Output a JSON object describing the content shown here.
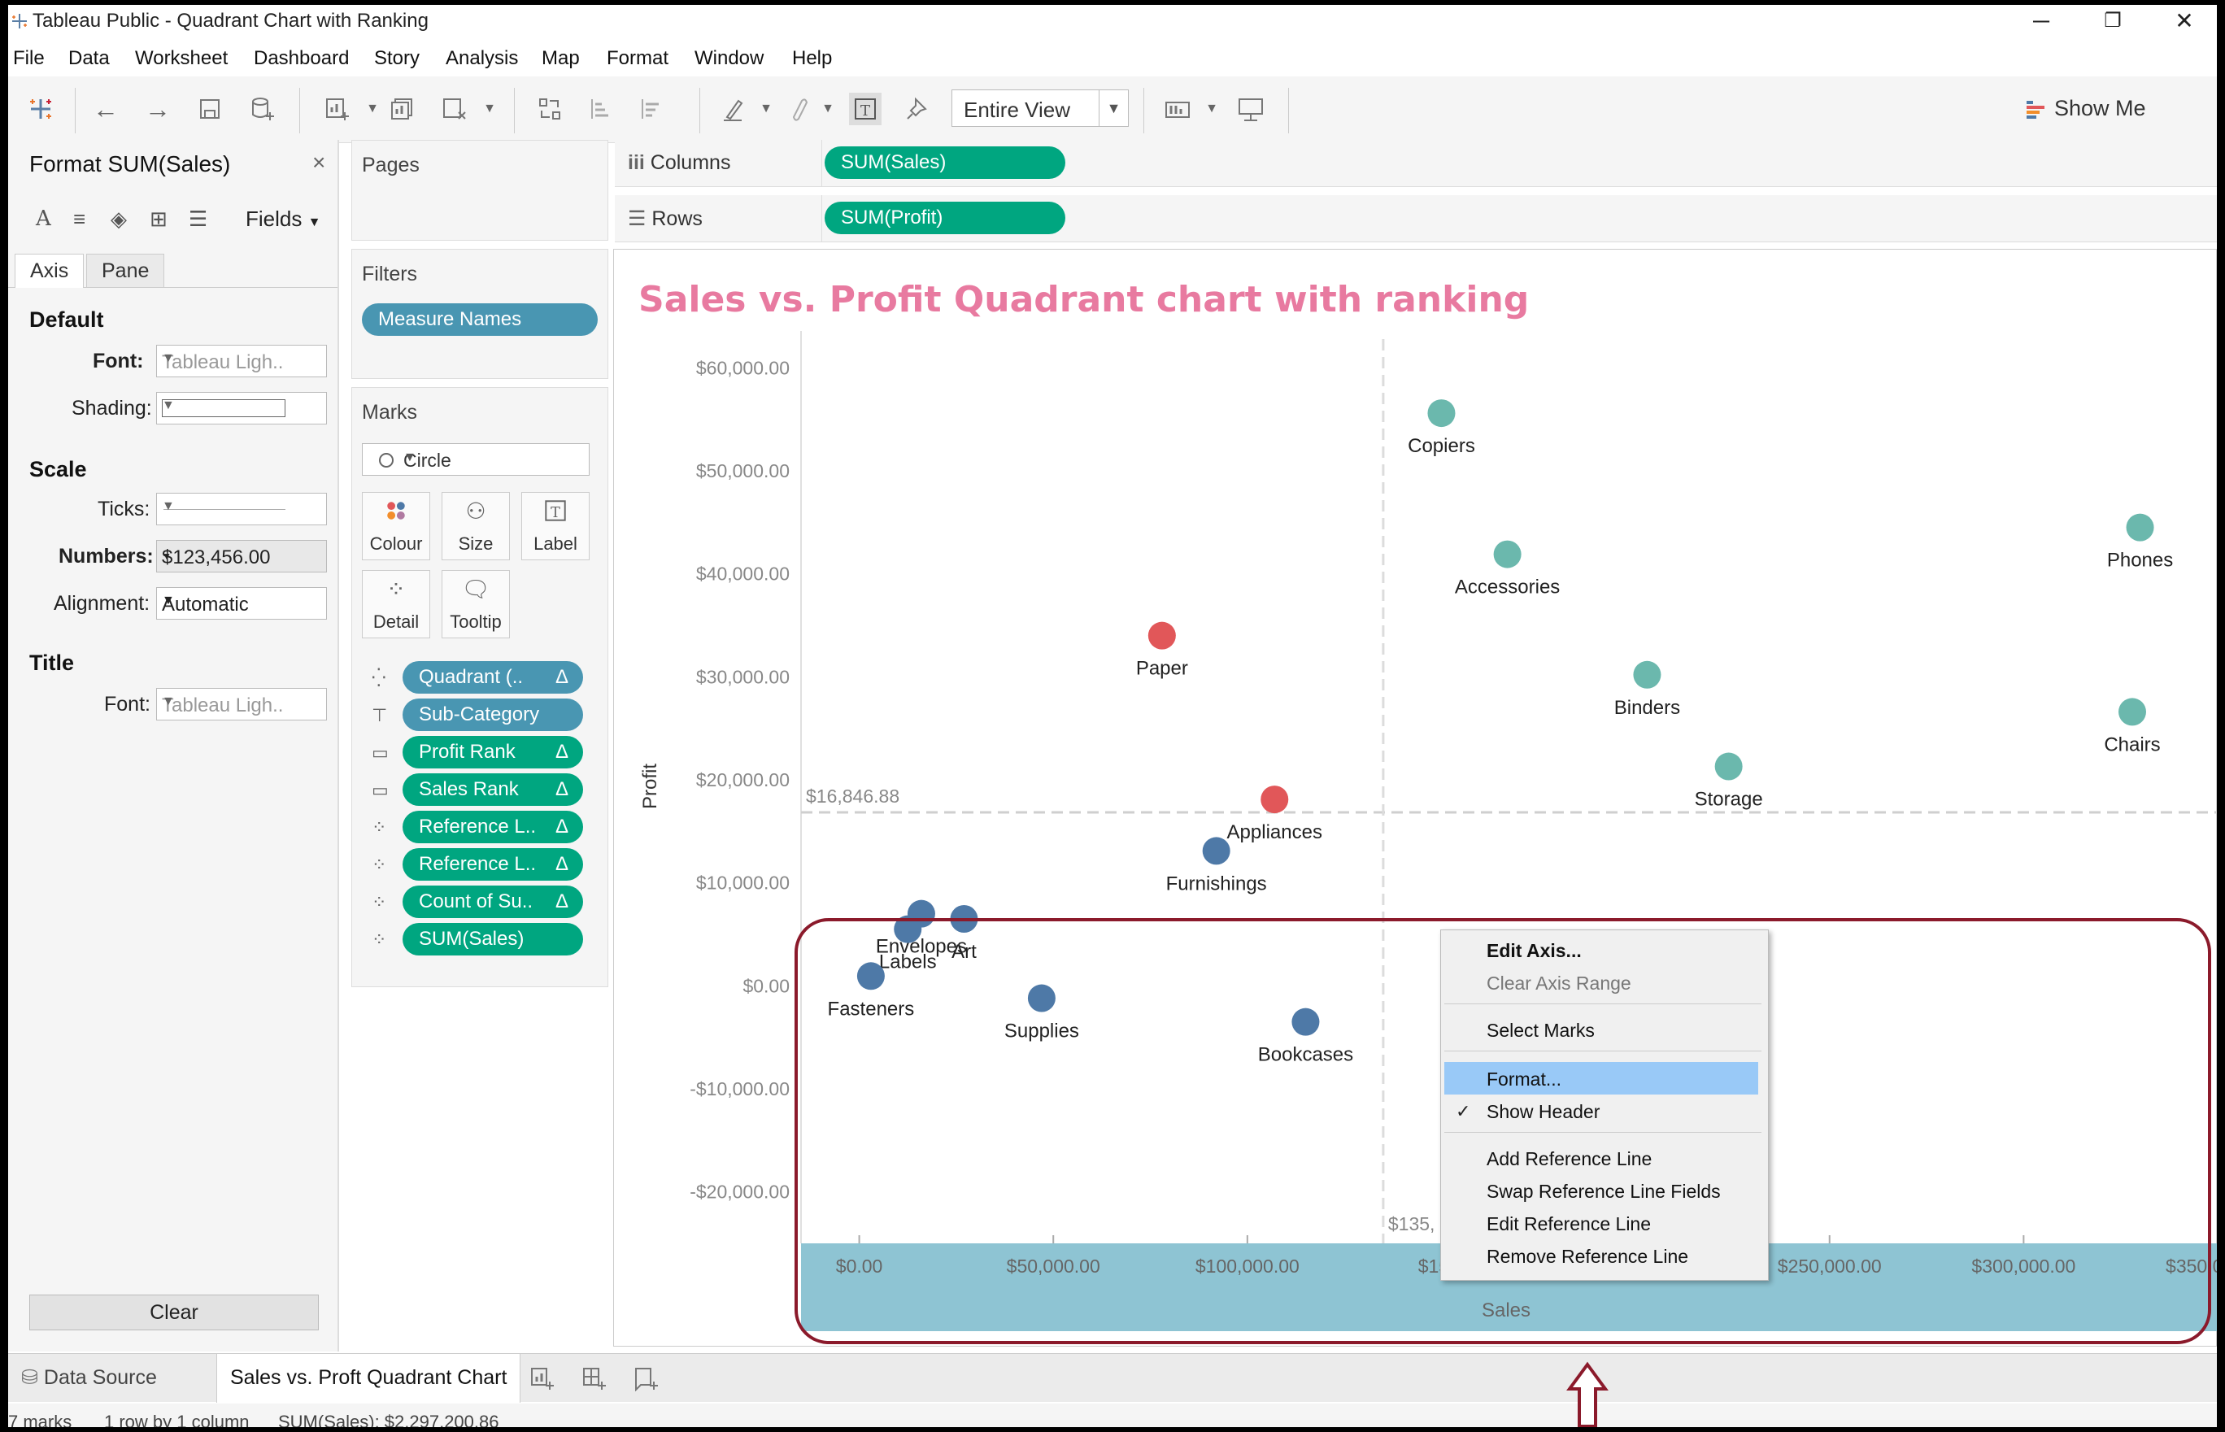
{
  "window": {
    "title": "Tableau Public - Quadrant Chart with Ranking",
    "minimize": "─",
    "restore": "❐",
    "close": "✕"
  },
  "menu": [
    "File",
    "Data",
    "Worksheet",
    "Dashboard",
    "Story",
    "Analysis",
    "Map",
    "Format",
    "Window",
    "Help"
  ],
  "toolbar": {
    "view_mode": "Entire View",
    "show_me": "Show Me"
  },
  "format_pane": {
    "title": "Format SUM(Sales)",
    "close": "×",
    "fields_label": "Fields",
    "tabs": [
      "Axis",
      "Pane"
    ],
    "sections": {
      "default": "Default",
      "scale": "Scale",
      "title": "Title"
    },
    "font_label": "Font:",
    "font_value": "Tableau Ligh..",
    "shading_label": "Shading:",
    "ticks_label": "Ticks:",
    "numbers_label": "Numbers:",
    "numbers_value": "$123,456.00",
    "alignment_label": "Alignment:",
    "alignment_value": "Automatic",
    "title_font_label": "Font:",
    "title_font_value": "Tableau Ligh..",
    "clear": "Clear"
  },
  "pages": {
    "label": "Pages"
  },
  "filters": {
    "label": "Filters",
    "pills": [
      "Measure Names"
    ]
  },
  "marks": {
    "label": "Marks",
    "type": "Circle",
    "buttons": [
      "Colour",
      "Size",
      "Label",
      "Detail",
      "Tooltip"
    ],
    "pills": [
      {
        "text": "Quadrant (..",
        "color": "blue",
        "delta": "Δ"
      },
      {
        "text": "Sub-Category",
        "color": "blue",
        "delta": ""
      },
      {
        "text": "Profit Rank",
        "color": "green",
        "delta": "Δ"
      },
      {
        "text": "Sales Rank",
        "color": "green",
        "delta": "Δ"
      },
      {
        "text": "Reference L..",
        "color": "green",
        "delta": "Δ"
      },
      {
        "text": "Reference L..",
        "color": "green",
        "delta": "Δ"
      },
      {
        "text": "Count of Su..",
        "color": "green",
        "delta": "Δ"
      },
      {
        "text": "SUM(Sales)",
        "color": "green",
        "delta": ""
      }
    ]
  },
  "shelves": {
    "columns_label": "Columns",
    "columns_pill": "SUM(Sales)",
    "rows_label": "Rows",
    "rows_pill": "SUM(Profit)"
  },
  "colors": {
    "accent_title": "#e87aa0",
    "teal": "#6bb8ad",
    "red": "#e15759",
    "navy": "#4e79a7",
    "axis_band": "#8ec4d3",
    "highlight": "#8b1a2b"
  },
  "chart_data": {
    "type": "scatter",
    "title": "Sales vs. Profit Quadrant chart with ranking",
    "xlabel": "Sales",
    "ylabel": "Profit",
    "xlim": [
      -15000,
      350000
    ],
    "ylim": [
      -25000,
      62000
    ],
    "x_ticks": [
      0,
      50000,
      100000,
      150000,
      250000,
      300000,
      350000
    ],
    "x_tick_labels": [
      "$0.00",
      "$50,000.00",
      "$100,000.00",
      "$150,",
      "$250,000.00",
      "$300,000.00",
      "$350,000.00"
    ],
    "y_ticks": [
      60000,
      50000,
      40000,
      30000,
      20000,
      10000,
      0,
      -10000,
      -20000
    ],
    "y_tick_labels": [
      "$60,000.00",
      "$50,000.00",
      "$40,000.00",
      "$30,000.00",
      "$20,000.00",
      "$10,000.00",
      "$0.00",
      "-$10,000.00",
      "-$20,000.00"
    ],
    "reference_lines": {
      "profit": {
        "value": 16846.88,
        "label": "$16,846.88"
      },
      "sales": {
        "value": 135000,
        "label": "$135,"
      }
    },
    "points": [
      {
        "name": "Copiers",
        "sales": 150000,
        "profit": 55600,
        "color": "#6bb8ad"
      },
      {
        "name": "Phones",
        "sales": 330000,
        "profit": 44500,
        "color": "#6bb8ad"
      },
      {
        "name": "Accessories",
        "sales": 167000,
        "profit": 41900,
        "color": "#6bb8ad"
      },
      {
        "name": "Paper",
        "sales": 78000,
        "profit": 34000,
        "color": "#e15759"
      },
      {
        "name": "Binders",
        "sales": 203000,
        "profit": 30200,
        "color": "#6bb8ad"
      },
      {
        "name": "Chairs",
        "sales": 328000,
        "profit": 26600,
        "color": "#6bb8ad"
      },
      {
        "name": "Storage",
        "sales": 224000,
        "profit": 21300,
        "color": "#6bb8ad"
      },
      {
        "name": "Appliances",
        "sales": 107000,
        "profit": 18100,
        "color": "#e15759"
      },
      {
        "name": "Furnishings",
        "sales": 92000,
        "profit": 13100,
        "color": "#4e79a7"
      },
      {
        "name": "Envelopes",
        "sales": 16000,
        "profit": 7000,
        "color": "#4e79a7"
      },
      {
        "name": "Art",
        "sales": 27000,
        "profit": 6500,
        "color": "#4e79a7"
      },
      {
        "name": "Labels",
        "sales": 12500,
        "profit": 5500,
        "color": "#4e79a7"
      },
      {
        "name": "Fasteners",
        "sales": 3000,
        "profit": 950,
        "color": "#4e79a7"
      },
      {
        "name": "Supplies",
        "sales": 47000,
        "profit": -1200,
        "color": "#4e79a7"
      },
      {
        "name": "Bookcases",
        "sales": 115000,
        "profit": -3500,
        "color": "#4e79a7"
      }
    ]
  },
  "context_menu": {
    "items": [
      "Edit Axis...",
      "Clear Axis Range",
      "Select Marks",
      "Format...",
      "Show Header",
      "Add Reference Line",
      "Swap Reference Line Fields",
      "Edit Reference Line",
      "Remove Reference Line"
    ],
    "check": "✓"
  },
  "bottom": {
    "data_source": "Data Source",
    "sheet_tab": "Sales vs. Proft Quadrant Chart"
  },
  "status": {
    "marks": "7 marks",
    "rows": "1 row by 1 column",
    "sum": "SUM(Sales): $2,297,200.86"
  }
}
